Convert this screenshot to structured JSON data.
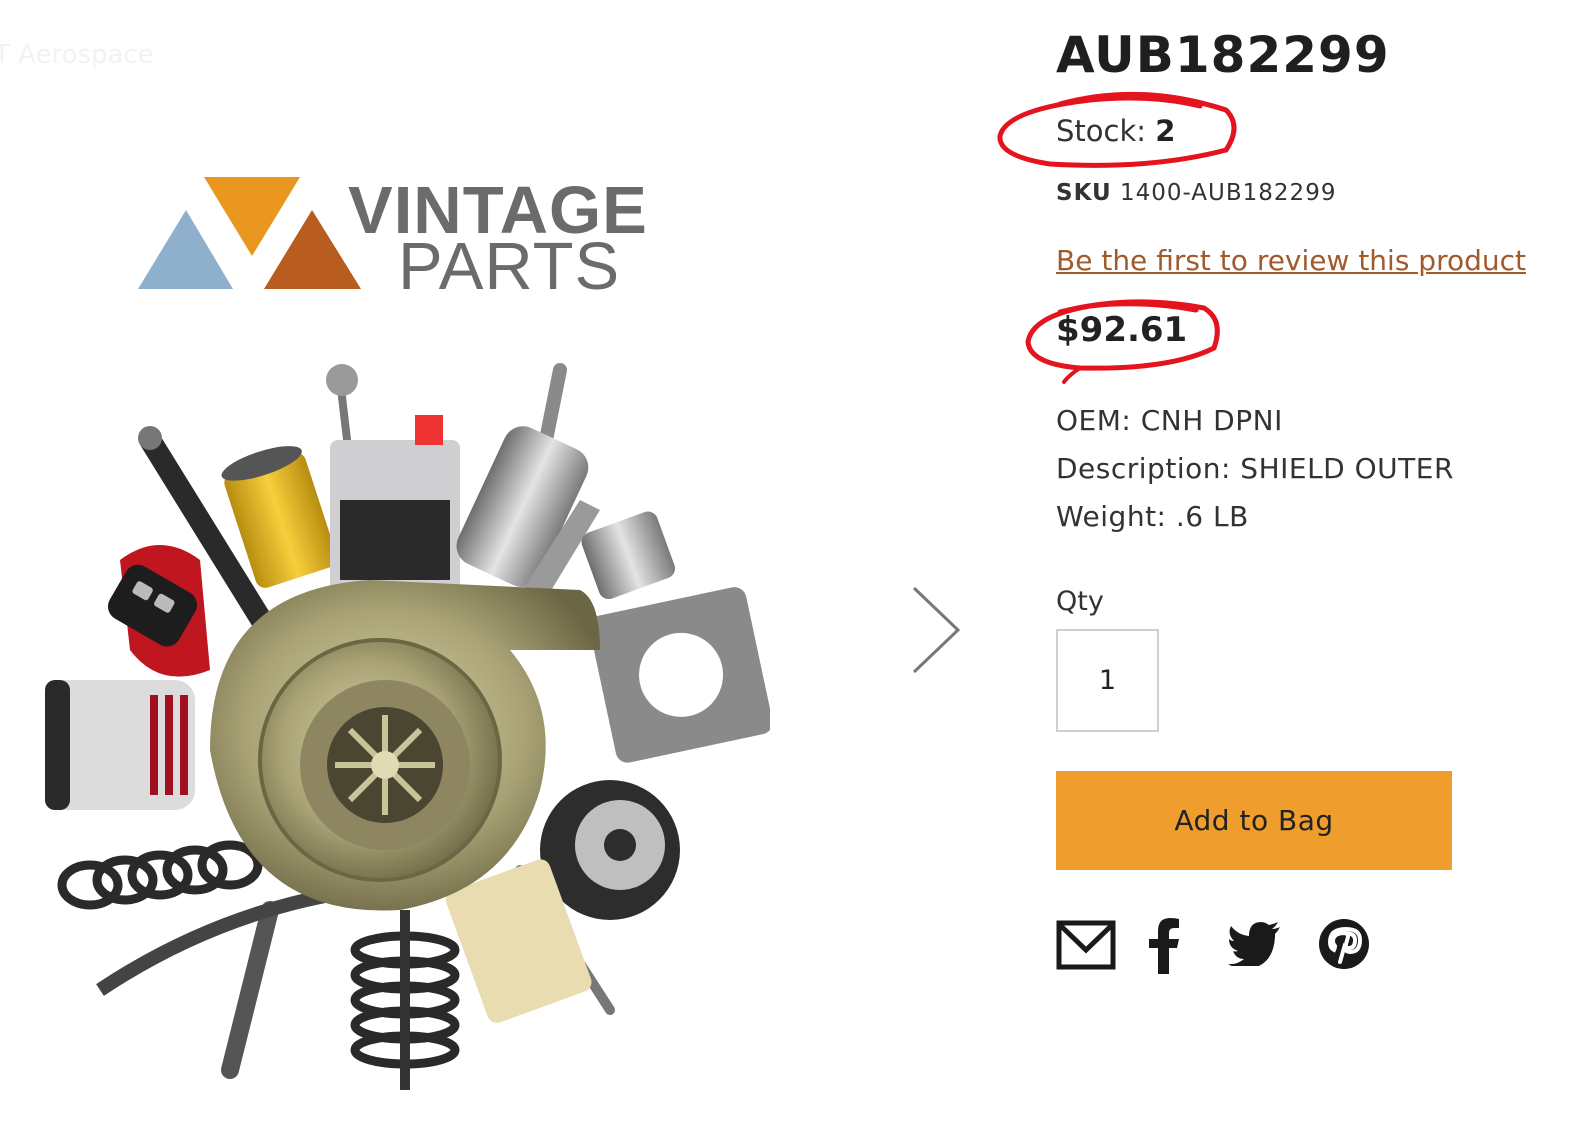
{
  "background_text": "T Aerospace",
  "brand": {
    "word1": "VINTAGE",
    "word2": "PARTS"
  },
  "colors": {
    "accent_button": "#ef9e2e",
    "review_link": "#a05a2c",
    "annotation_circle": "#e3141d",
    "logo_blue": "#8fb0cd",
    "logo_orange": "#e9971e",
    "logo_rust": "#b85c1f",
    "logo_text": "#6b6b6b"
  },
  "product": {
    "title": "AUB182299",
    "stock_label": "Stock:",
    "stock_value": "2",
    "sku_label": "SKU",
    "sku_value": "1400-AUB182299",
    "review_link": "Be the first to review this product",
    "price": "$92.61",
    "oem": "OEM: CNH DPNI",
    "description": "Description: SHIELD OUTER",
    "weight": "Weight: .6 LB"
  },
  "qty": {
    "label": "Qty",
    "value": "1"
  },
  "actions": {
    "add_to_bag": "Add to Bag"
  },
  "share_icons": [
    "email-icon",
    "facebook-icon",
    "twitter-icon",
    "pinterest-icon"
  ],
  "gallery": {
    "next_icon": "chevron-right-icon"
  }
}
